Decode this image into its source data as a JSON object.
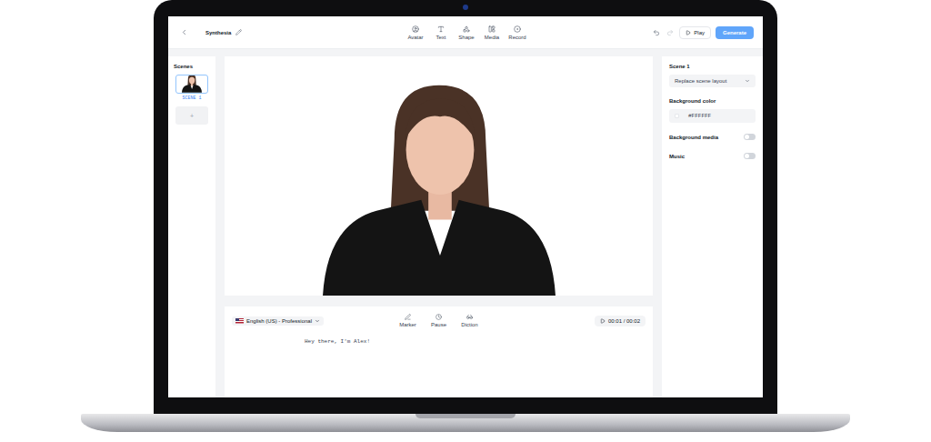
{
  "app": {
    "title": "Synthesia"
  },
  "toolbar": [
    {
      "label": "Avatar"
    },
    {
      "label": "Text"
    },
    {
      "label": "Shape"
    },
    {
      "label": "Media"
    },
    {
      "label": "Record"
    }
  ],
  "history": {
    "undo_disabled": false,
    "redo_disabled": true
  },
  "actions": {
    "play": "Play",
    "generate": "Generate"
  },
  "scenes": {
    "title": "Scenes",
    "items": [
      {
        "label": "SCENE 1",
        "selected": true
      }
    ],
    "add": "+"
  },
  "script": {
    "language": "English (US) - Professional",
    "tools": [
      "Marker",
      "Pause",
      "Diction"
    ],
    "time": "00:01 / 00:02",
    "text": "Hey there, I'm Alex!"
  },
  "properties": {
    "title": "Scene 1",
    "layout": "Replace scene layout",
    "background_color_label": "Background color",
    "background_color": "#FFFFFF",
    "toggles": [
      {
        "label": "Background media",
        "on": false
      },
      {
        "label": "Music",
        "on": false
      }
    ]
  }
}
